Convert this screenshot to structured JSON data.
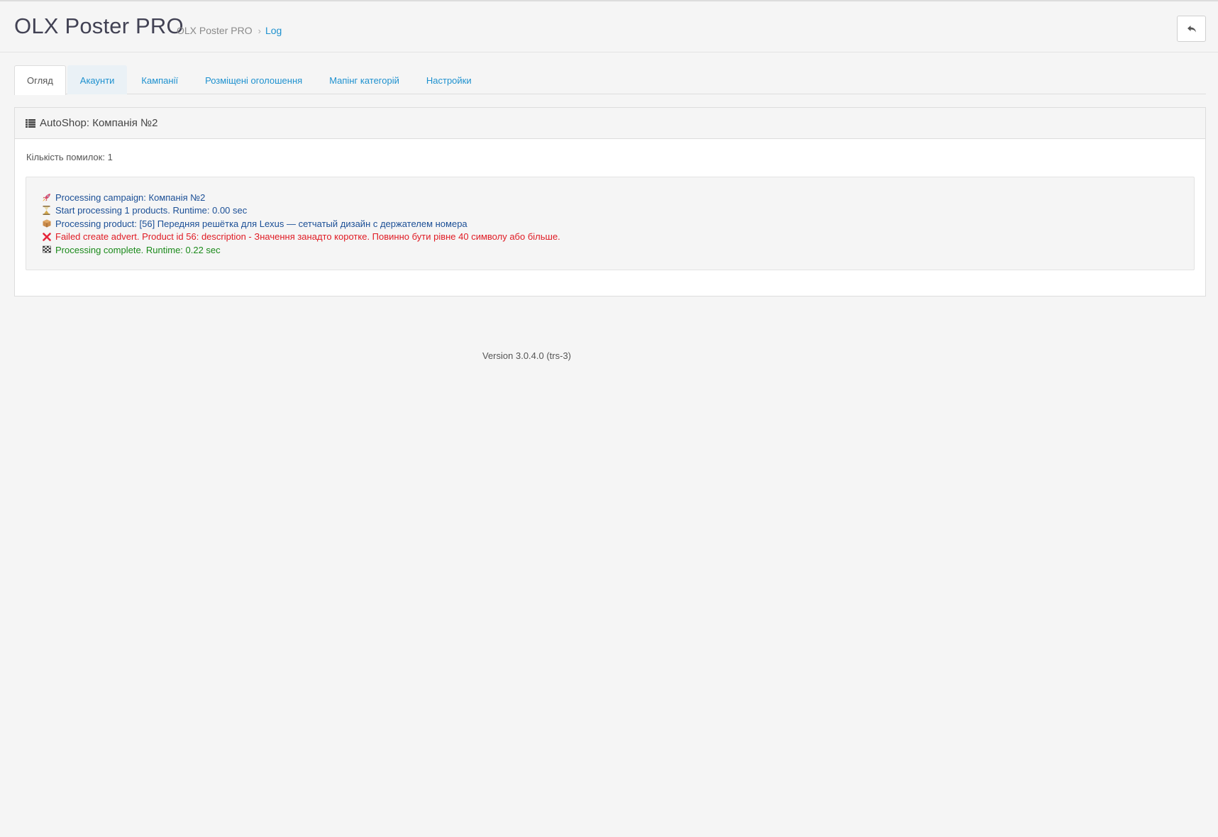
{
  "header": {
    "title": "OLX Poster PRO",
    "breadcrumb": [
      {
        "label": "OLX Poster PRO"
      },
      {
        "label": "Log"
      }
    ],
    "back_button_icon": "reply-icon"
  },
  "tabs": [
    {
      "label": "Огляд",
      "active": true
    },
    {
      "label": "Акаунти",
      "active": false
    },
    {
      "label": "Кампанії",
      "active": false
    },
    {
      "label": "Розміщені оголошення",
      "active": false
    },
    {
      "label": "Мапінг категорій",
      "active": false
    },
    {
      "label": "Настройки",
      "active": false
    }
  ],
  "panel": {
    "icon": "list-icon",
    "title": "AutoShop: Компанія №2",
    "error_count": "Кількість помилок: 1",
    "log": [
      {
        "icon": "rocket-icon",
        "text": "Processing campaign: Компанія №2",
        "status": "info"
      },
      {
        "icon": "hourglass-icon",
        "text": "Start processing 1 products. Runtime: 0.00 sec",
        "status": "info"
      },
      {
        "icon": "package-icon",
        "text": "Processing product: [56] Передняя решётка для Lexus — сетчатый дизайн с держателем номера",
        "status": "info"
      },
      {
        "icon": "cross-mark-icon",
        "text": "Failed create advert. Product id 56: description - Значення занадто коротке. Повинно бути рівне 40 символу або більше.",
        "status": "error"
      },
      {
        "icon": "checkered-flag-icon",
        "text": "Processing complete. Runtime: 0.22 sec",
        "status": "success"
      }
    ]
  },
  "footer": {
    "version": "Version 3.0.4.0 (trs-3)"
  },
  "colors": {
    "link": "#1e91cf",
    "info": "#1b4f96",
    "error": "#e01b24",
    "success": "#1a8a1a",
    "background": "#f5f5f5"
  }
}
